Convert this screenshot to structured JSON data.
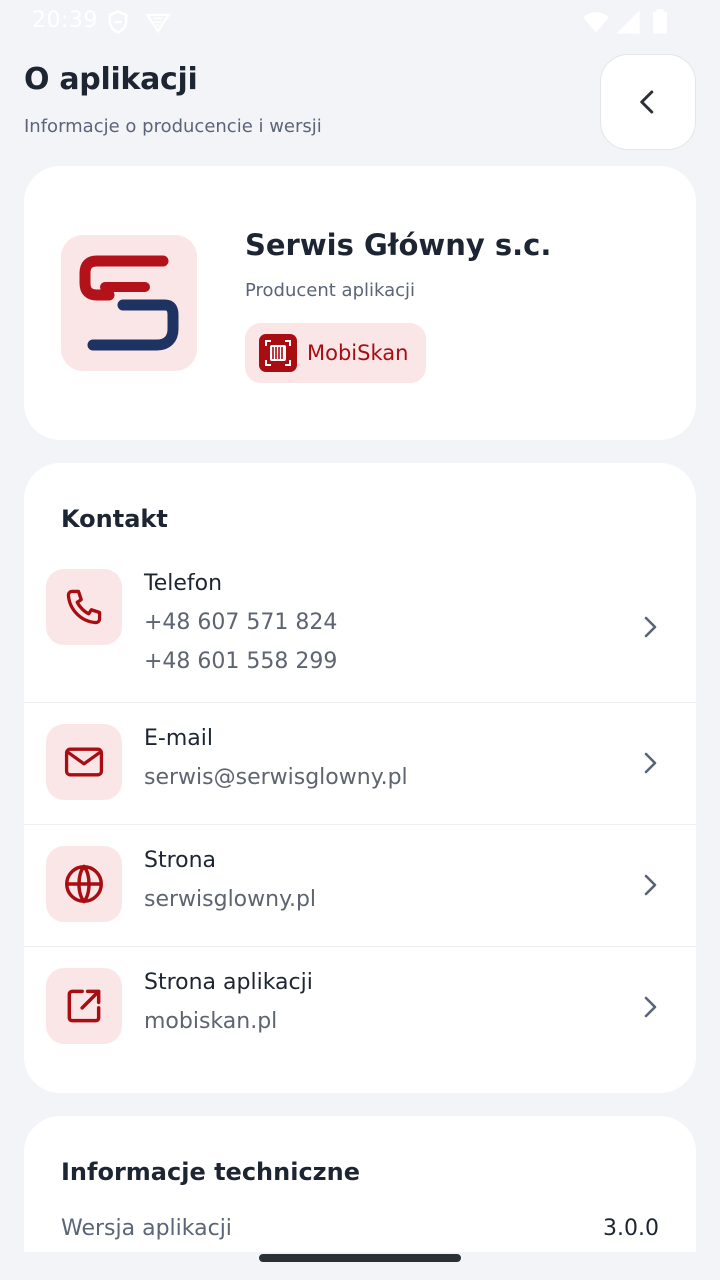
{
  "status_bar": {
    "time": "20:39"
  },
  "header": {
    "title": "O aplikacji",
    "subtitle": "Informacje o producencie i wersji",
    "back_icon": "chevron-left-icon"
  },
  "producer": {
    "name": "Serwis Główny s.c.",
    "role": "Producent aplikacji",
    "app_name": "MobiSkan",
    "logo_text": "SG"
  },
  "contact": {
    "title": "Kontakt",
    "items": [
      {
        "label": "Telefon",
        "values": [
          "+48 607 571 824",
          "+48 601 558 299"
        ],
        "icon": "phone-icon"
      },
      {
        "label": "E-mail",
        "values": [
          "serwis@serwisglowny.pl"
        ],
        "icon": "mail-icon"
      },
      {
        "label": "Strona",
        "values": [
          "serwisglowny.pl"
        ],
        "icon": "globe-icon"
      },
      {
        "label": "Strona aplikacji",
        "values": [
          "mobiskan.pl"
        ],
        "icon": "external-link-icon"
      }
    ]
  },
  "tech": {
    "title": "Informacje techniczne",
    "rows": [
      {
        "label": "Wersja aplikacji",
        "value": "3.0.0"
      }
    ]
  },
  "colors": {
    "accent": "#a80d12",
    "accent_soft": "#fae6e7",
    "logo_navy": "#1f3363",
    "background": "#f3f4f7"
  }
}
